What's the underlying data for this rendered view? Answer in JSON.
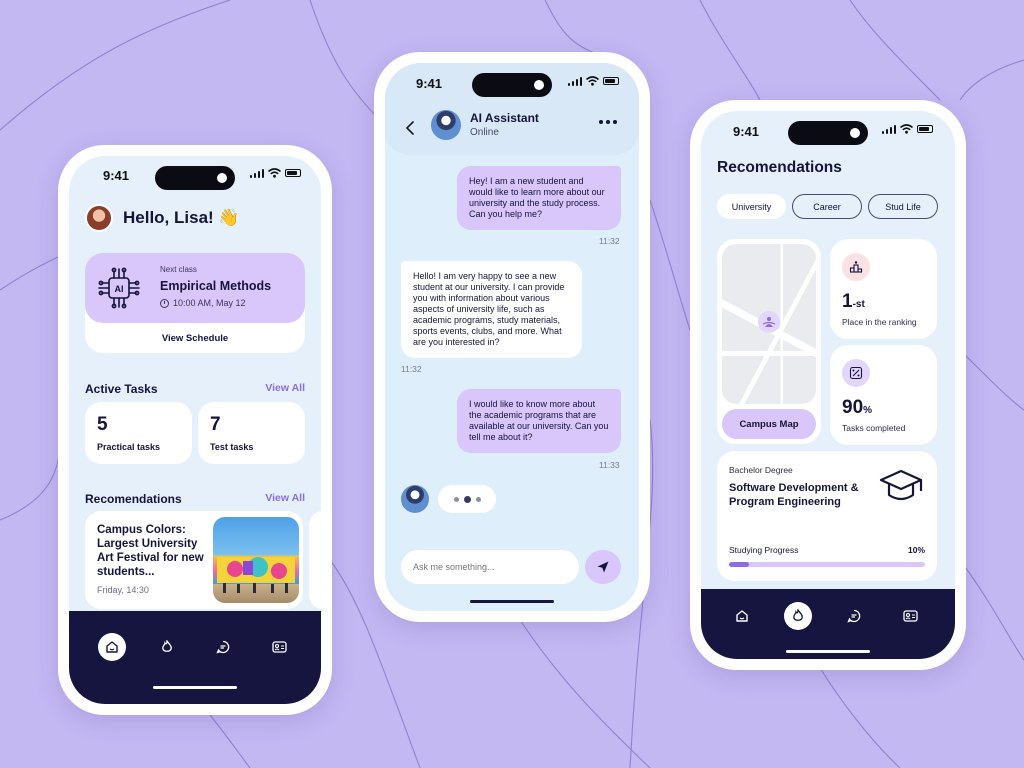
{
  "status": {
    "time": "9:41"
  },
  "home": {
    "greeting": "Hello, Lisa! 👋",
    "next_class": {
      "label": "Next class",
      "title": "Empirical Methods",
      "time": "10:00 AM, May 12",
      "action": "View Schedule",
      "icon": "ai-chip-icon"
    },
    "active_tasks": {
      "title": "Active Tasks",
      "link": "View All",
      "cards": [
        {
          "count": "5",
          "label": "Practical tasks"
        },
        {
          "count": "7",
          "label": "Test tasks"
        }
      ]
    },
    "recommendations": {
      "title": "Recomendations",
      "link": "View All",
      "card": {
        "title": "Campus Colors: Largest University Art Festival for new students...",
        "date": "Friday, 14:30"
      },
      "pager": {
        "count": 3,
        "active": 0
      }
    },
    "tabs": [
      "home-icon",
      "flame-icon",
      "chat-icon",
      "id-card-icon"
    ],
    "active_tab": 0
  },
  "chat": {
    "name": "AI Assistant",
    "status": "Online",
    "messages": [
      {
        "from": "me",
        "text": "Hey! I am a new student and would like to learn more about our university and the study process. Can you help me?",
        "time": "11:32"
      },
      {
        "from": "bot",
        "text": "Hello! I am very happy to see a new student at our university. I can provide you with information about various aspects of university life, such as academic programs, study materials, sports events, clubs, and more. What are you interested in?",
        "time": "11:32"
      },
      {
        "from": "me",
        "text": "I would like to know more about the academic programs that are available at our university. Can you tell me about it?",
        "time": "11:33"
      }
    ],
    "input_placeholder": "Ask me something..."
  },
  "recs": {
    "title": "Recomendations",
    "filters": [
      "University",
      "Career",
      "Stud Life"
    ],
    "selected_filter": 0,
    "map_button": "Campus Map",
    "ranking": {
      "value": "1",
      "suffix": "-st",
      "label": "Place in the ranking"
    },
    "tasks": {
      "value": "90",
      "suffix": "%",
      "label": "Tasks completed"
    },
    "degree": {
      "label": "Bachelor Degree",
      "title": "Software Development & Program Engineering",
      "progress_label": "Studying Progress",
      "progress_text": "10%",
      "progress": 0.1
    },
    "active_tab": 1
  },
  "colors": {
    "background": "#c3b8f2",
    "accent_purple": "#d9c6fb",
    "accent_strong": "#8e6be3",
    "navy": "#16153f",
    "link": "#8a6ee0"
  }
}
